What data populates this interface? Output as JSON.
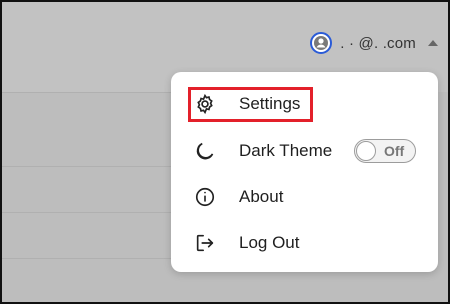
{
  "header": {
    "account_email": ".  ·   @.    .com",
    "avatar_icon": "user-circle-icon",
    "expand_icon": "caret-up-icon"
  },
  "menu": {
    "items": [
      {
        "label": "Settings",
        "icon": "gear-icon"
      },
      {
        "label": "Dark Theme",
        "icon": "moon-icon",
        "toggle_state": "Off"
      },
      {
        "label": "About",
        "icon": "info-icon"
      },
      {
        "label": "Log Out",
        "icon": "logout-icon"
      }
    ]
  },
  "colors": {
    "highlight": "#e3202a",
    "avatar_ring": "#2a5bd7"
  }
}
